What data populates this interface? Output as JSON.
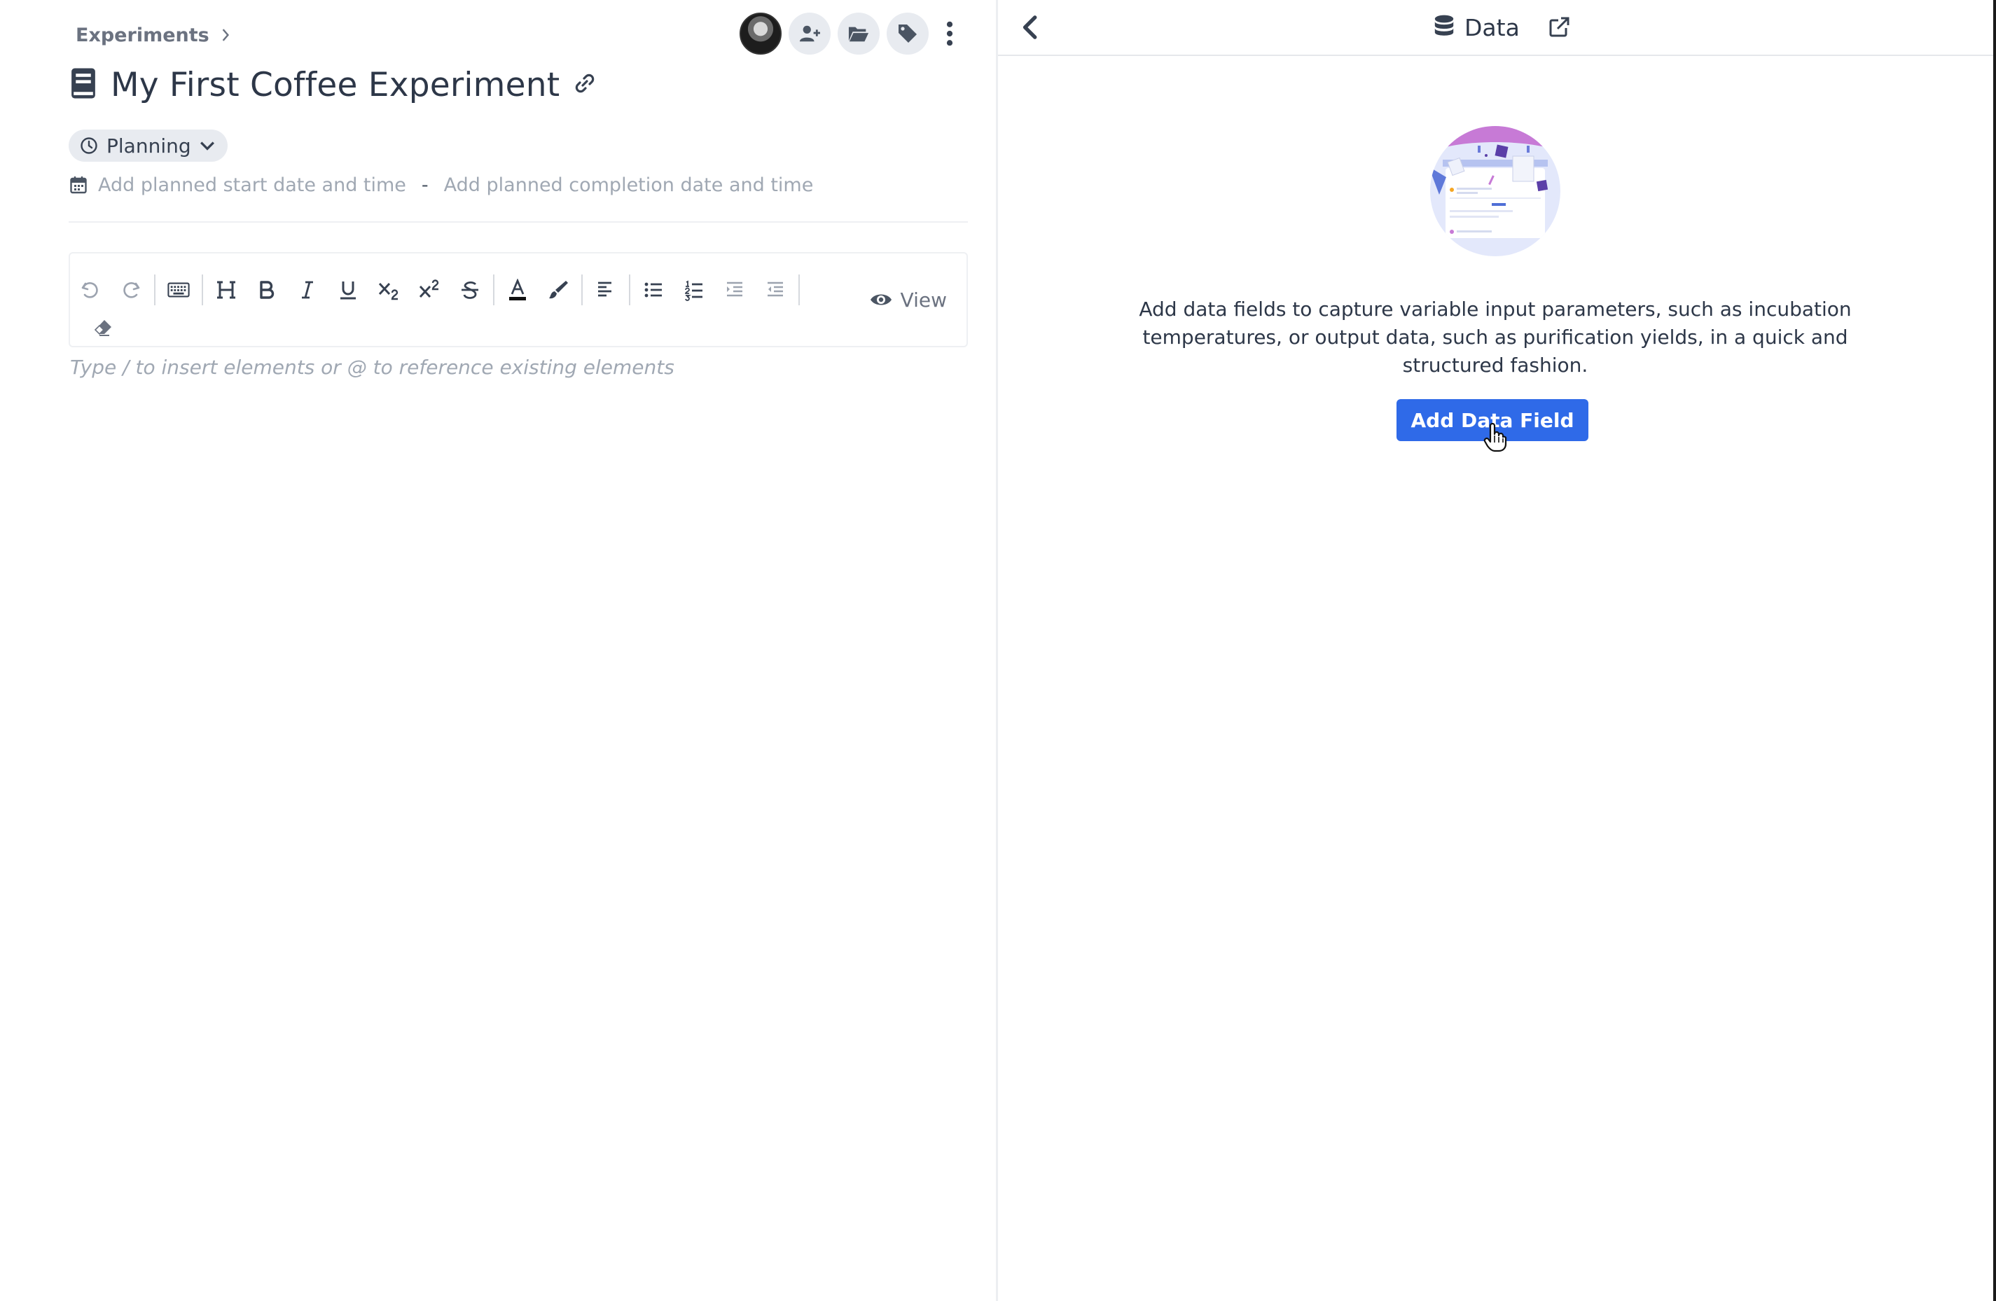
{
  "breadcrumb": {
    "label": "Experiments"
  },
  "header": {
    "title": "My First Coffee Experiment",
    "actions": [
      "user-avatar",
      "add-user-icon",
      "folder-icon",
      "tag-icon",
      "more-vertical-icon"
    ]
  },
  "status": {
    "label": "Planning"
  },
  "dates": {
    "start_placeholder": "Add planned start date and time",
    "separator": "-",
    "end_placeholder": "Add planned completion date and time"
  },
  "toolbar": {
    "tools": [
      "undo-icon",
      "redo-icon",
      "keyboard-icon",
      "heading-icon",
      "bold-icon",
      "italic-icon",
      "underline-icon",
      "subscript-icon",
      "superscript-icon",
      "strikethrough-icon",
      "text-color-icon",
      "highlight-icon",
      "align-left-icon",
      "bullet-list-icon",
      "numbered-list-icon",
      "indent-icon",
      "outdent-icon",
      "clear-format-icon"
    ],
    "view_label": "View"
  },
  "editor": {
    "placeholder": "Type / to insert elements or @ to reference existing elements"
  },
  "data_panel": {
    "title": "Data",
    "description": "Add data fields to capture variable input parameters, such as incubation temperatures, or output data, such as purification yields, in a quick and structured fashion.",
    "add_button": "Add Data Field"
  },
  "colors": {
    "primary": "#2f6ae8",
    "text": "#2d3748",
    "muted": "#a0a8b3",
    "chip_bg": "#e8ebf0"
  }
}
